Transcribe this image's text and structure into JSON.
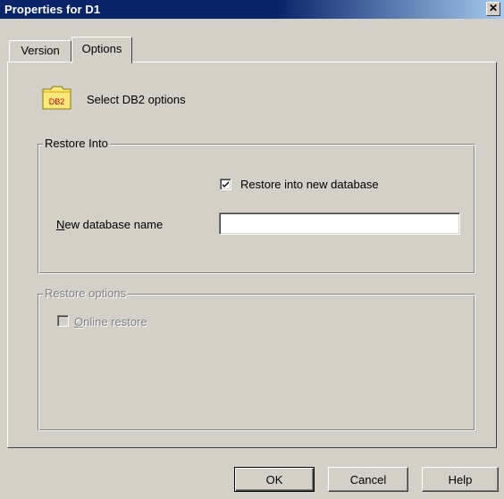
{
  "window": {
    "title": "Properties for D1",
    "close_glyph": "✕"
  },
  "tabs": [
    {
      "label": "Version",
      "active": false
    },
    {
      "label": "Options",
      "active": true
    }
  ],
  "header": {
    "icon": "db2-folder-icon",
    "icon_text": "DB2",
    "text": "Select DB2 options"
  },
  "restore_into": {
    "legend": "Restore Into",
    "checkbox_label": "Restore into new database",
    "checked": true,
    "field_label_mnemonic": "N",
    "field_label_rest": "ew database name",
    "field_value": ""
  },
  "restore_options": {
    "legend": "Restore options",
    "disabled": true,
    "checkbox_label_mnemonic": "O",
    "checkbox_label_rest": "nline restore",
    "checked": false
  },
  "buttons": {
    "ok": "OK",
    "cancel": "Cancel",
    "help": "Help"
  },
  "colors": {
    "titlebar_start": "#0a246a",
    "titlebar_end": "#a6caf0",
    "face": "#d4d0c8",
    "icon_folder": "#ffe77a"
  }
}
